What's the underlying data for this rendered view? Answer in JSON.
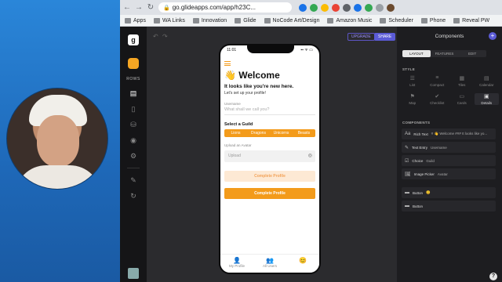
{
  "browser": {
    "url": "go.glideapps.com/app/h23C...",
    "bookmarks": [
      {
        "label": "Apps"
      },
      {
        "label": "WA Links"
      },
      {
        "label": "Innovation"
      },
      {
        "label": "Glide"
      },
      {
        "label": "NoCode Art/Design"
      },
      {
        "label": "Amazon Music"
      },
      {
        "label": "Scheduler"
      },
      {
        "label": "Phone"
      },
      {
        "label": "Reveal PW"
      }
    ]
  },
  "rail": {
    "logo": "g",
    "rows_label": "ROWS"
  },
  "canvas": {
    "upgrade_label": "UPGRADE",
    "share_label": "SHARE"
  },
  "phone": {
    "time": "11:01",
    "signal": "▪▪ ᯤ ▭",
    "title": "👋 Welcome",
    "subtitle": "It looks like you're new here.",
    "description": "Let's set up your profile!",
    "username_label": "Username",
    "username_placeholder": "What shall we call you?",
    "guild_heading": "Select a Guild",
    "guild_options": [
      "Lions",
      "Dragons",
      "Unicorns",
      "Beasts"
    ],
    "avatar_label": "Upload an Avatar",
    "avatar_placeholder": "Upload",
    "button_disabled": "Complete Profile",
    "button_primary": "Complete Profile",
    "tabs": [
      {
        "icon": "👤",
        "label": "My Profile"
      },
      {
        "icon": "👥",
        "label": "All Users"
      },
      {
        "icon": "😊",
        "label": ""
      }
    ]
  },
  "panel": {
    "title": "Components",
    "tabs": [
      "LAYOUT",
      "FEATURES",
      "EDIT"
    ],
    "style_label": "STYLE",
    "styles": [
      {
        "icon": "☰",
        "label": "List"
      },
      {
        "icon": "≡",
        "label": "Compact"
      },
      {
        "icon": "▦",
        "label": "Tiles"
      },
      {
        "icon": "▤",
        "label": "Calendar"
      },
      {
        "icon": "⚑",
        "label": "Map"
      },
      {
        "icon": "✔",
        "label": "Checklist"
      },
      {
        "icon": "▭",
        "label": "Cards"
      },
      {
        "icon": "▣",
        "label": "Details"
      }
    ],
    "components_label": "COMPONENTS",
    "components": [
      {
        "icon": "Aa",
        "name": "Rich Text",
        "value": "# 👋 Welcome ### It looks like yo..."
      },
      {
        "icon": "✎",
        "name": "Text Entry",
        "value": "Username"
      },
      {
        "icon": "☑",
        "name": "Choice",
        "value": "Guild"
      },
      {
        "icon": "🖼",
        "name": "Image Picker",
        "value": "Avatar"
      },
      {
        "icon": "▬",
        "name": "Button",
        "value": "😊"
      },
      {
        "icon": "▬",
        "name": "Button",
        "value": ""
      }
    ],
    "help": "?"
  }
}
